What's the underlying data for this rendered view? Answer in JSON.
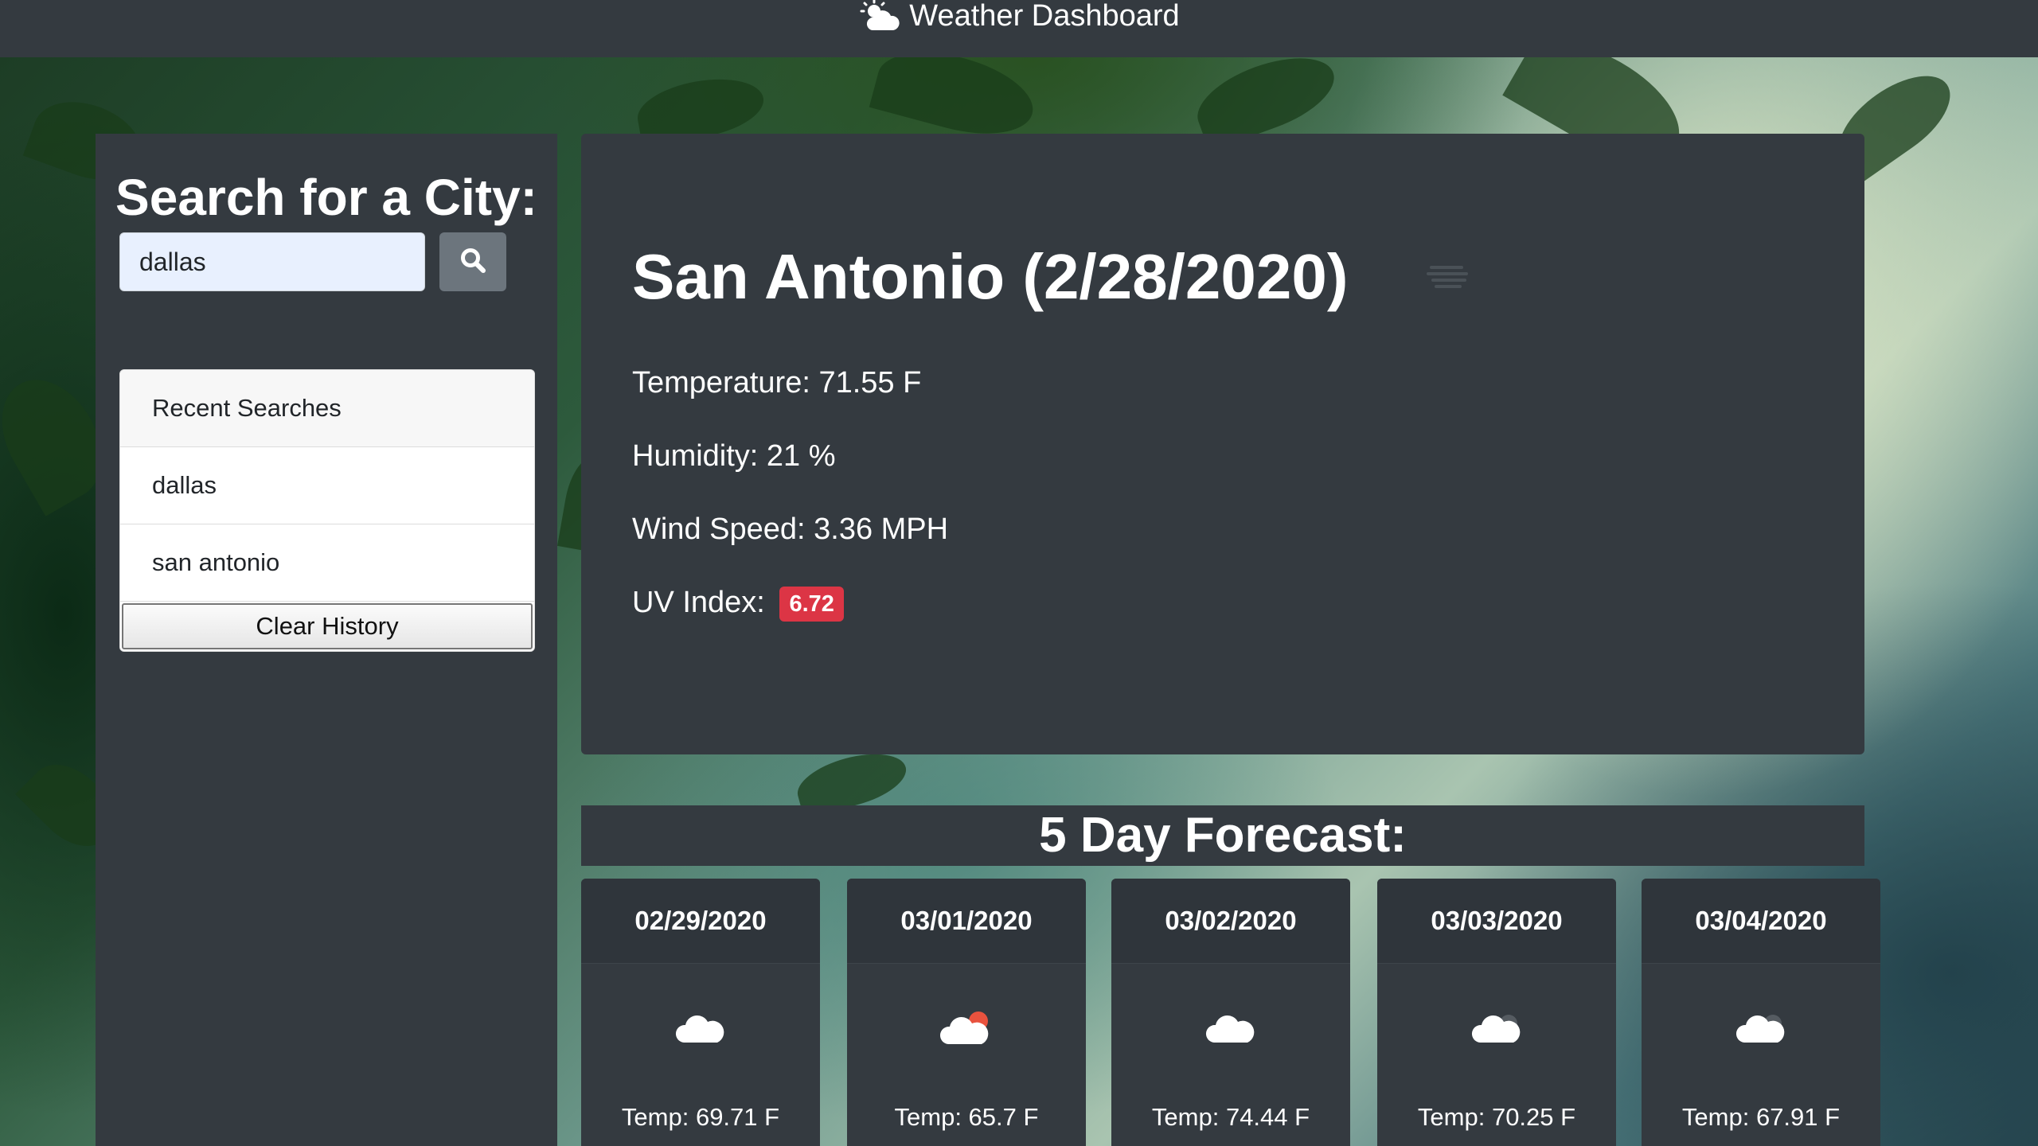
{
  "navbar": {
    "title": "Weather Dashboard",
    "icon": "cloud-sun-icon"
  },
  "search": {
    "heading": "Search for a City:",
    "input_value": "dallas",
    "button_icon": "search-icon"
  },
  "history": {
    "header": "Recent Searches",
    "items": [
      "dallas",
      "san antonio"
    ],
    "clear_label": "Clear History"
  },
  "current": {
    "title": "San Antonio (2/28/2020)",
    "icon": "mist-icon",
    "temperature": "Temperature: 71.55 F",
    "humidity": "Humidity: 21 %",
    "wind": "Wind Speed: 3.36 MPH",
    "uv_label": "UV Index:",
    "uv_value": "6.72",
    "uv_color": "#dc3545"
  },
  "forecast": {
    "heading": "5 Day Forecast:",
    "days": [
      {
        "date": "02/29/2020",
        "icon": "cloud-icon",
        "temp": "Temp: 69.71 F"
      },
      {
        "date": "03/01/2020",
        "icon": "cloud-sun-icon",
        "temp": "Temp: 65.7 F"
      },
      {
        "date": "03/02/2020",
        "icon": "cloud-icon",
        "temp": "Temp: 74.44 F"
      },
      {
        "date": "03/03/2020",
        "icon": "cloud-night-icon",
        "temp": "Temp: 70.25 F"
      },
      {
        "date": "03/04/2020",
        "icon": "cloud-night-icon",
        "temp": "Temp: 67.91 F"
      }
    ]
  }
}
